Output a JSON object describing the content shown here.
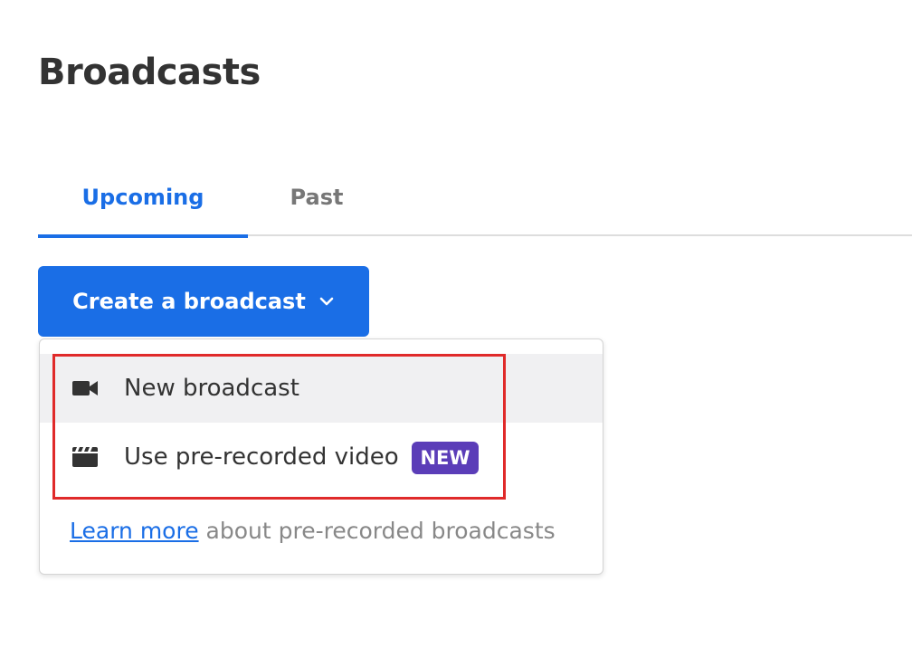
{
  "page": {
    "title": "Broadcasts"
  },
  "tabs": [
    {
      "label": "Upcoming",
      "active": true
    },
    {
      "label": "Past",
      "active": false
    }
  ],
  "create_button": {
    "label": "Create a broadcast",
    "icon": "chevron-down-icon"
  },
  "dropdown": {
    "items": [
      {
        "label": "New broadcast",
        "icon": "video-camera-icon",
        "highlighted": true
      },
      {
        "label": "Use pre-recorded video",
        "icon": "clapperboard-icon",
        "badge": "NEW"
      }
    ],
    "learn_more": {
      "link_text": "Learn more",
      "suffix_text": " about pre-recorded broadcasts"
    }
  },
  "colors": {
    "accent": "#1a6ee6",
    "badge": "#5b3db8",
    "annotation": "#e02a2a",
    "highlight_row": "#f0f0f2"
  }
}
